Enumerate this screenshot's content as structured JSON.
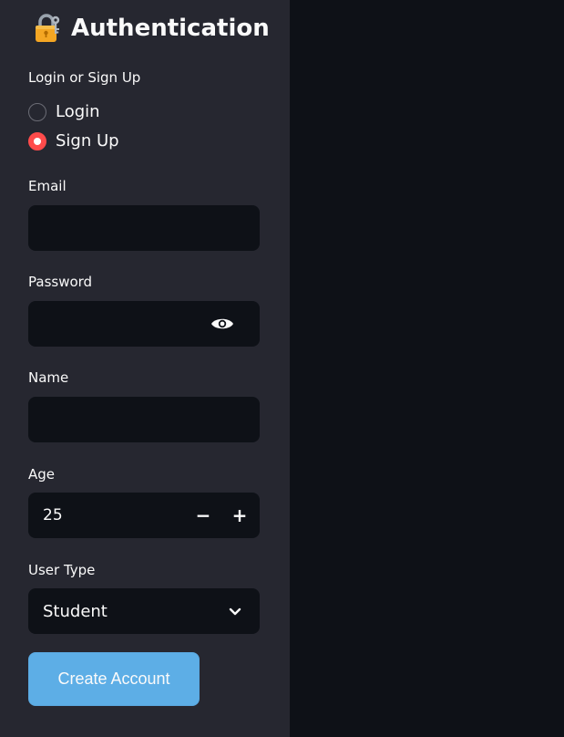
{
  "sidebar": {
    "title": "Authentication",
    "title_icon": "lock-with-key-icon",
    "mode_label": "Login or Sign Up",
    "mode_options": [
      {
        "label": "Login",
        "selected": false
      },
      {
        "label": "Sign Up",
        "selected": true
      }
    ],
    "email": {
      "label": "Email",
      "value": ""
    },
    "password": {
      "label": "Password",
      "value": "",
      "toggle_icon": "eye-icon"
    },
    "name": {
      "label": "Name",
      "value": ""
    },
    "age": {
      "label": "Age",
      "value": "25",
      "decrement": "−",
      "increment": "+"
    },
    "user_type": {
      "label": "User Type",
      "selected": "Student"
    },
    "submit_label": "Create Account"
  },
  "colors": {
    "sidebar_bg": "#262730",
    "main_bg": "#0e1117",
    "input_bg": "#0e1117",
    "accent_red": "#ff4b4b",
    "button_blue": "#5daee6",
    "text": "#fafafa"
  }
}
